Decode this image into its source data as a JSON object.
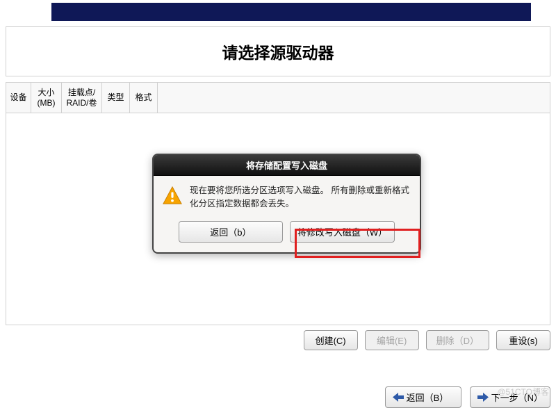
{
  "title": "请选择源驱动器",
  "table": {
    "headers": {
      "device": "设备",
      "size": "大小 (MB)",
      "mount": "挂载点/ RAID/卷",
      "type": "类型",
      "format": "格式"
    }
  },
  "dialog": {
    "title": "将存储配置写入磁盘",
    "message": "现在要将您所选分区选项写入磁盘。 所有删除或重新格式化分区指定数据都会丢失。",
    "buttons": {
      "back": "返回（b）",
      "write": "将修改写入磁盘（W）"
    }
  },
  "bottom_buttons": {
    "create": "创建(C)",
    "edit": "编辑(E)",
    "delete": "删除（D）",
    "reset": "重设(s)"
  },
  "nav": {
    "back": "返回（B）",
    "next": "下一步（N）"
  },
  "watermark": "@51CTO博客"
}
